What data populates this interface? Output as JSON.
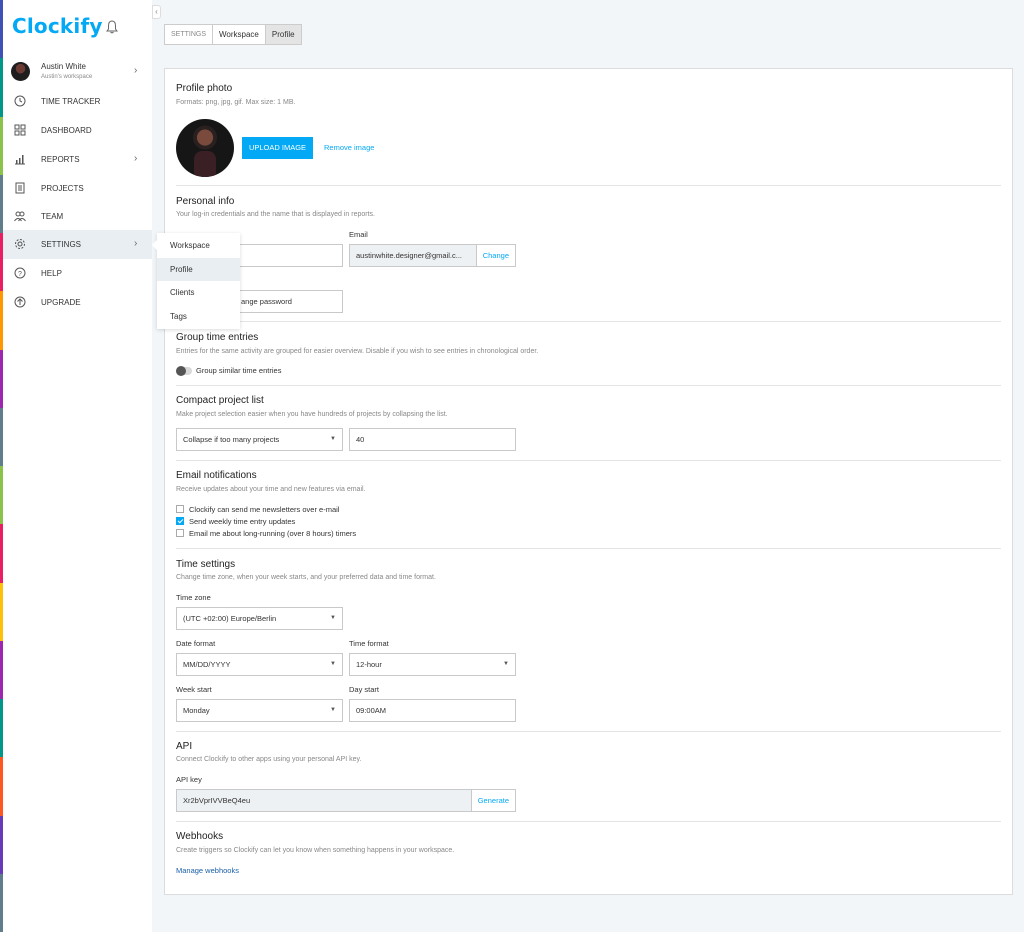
{
  "app": {
    "name": "Clockify",
    "accent": "#03a9f4"
  },
  "strip_colors": [
    "#3f51b5",
    "#009688",
    "#8bc34a",
    "#607d8b",
    "#e91e63",
    "#ff9800",
    "#9c27b0",
    "#607d8b",
    "#8bc34a",
    "#e91e63",
    "#ffc107",
    "#9c27b0",
    "#009688",
    "#ff5722",
    "#673ab7",
    "#607d8b"
  ],
  "user": {
    "name": "Austin White",
    "workspace": "Austin's workspace"
  },
  "nav": [
    {
      "label": "TIME TRACKER",
      "icon": "clock-icon"
    },
    {
      "label": "DASHBOARD",
      "icon": "grid-icon"
    },
    {
      "label": "REPORTS",
      "icon": "chart-icon"
    },
    {
      "label": "PROJECTS",
      "icon": "document-icon"
    },
    {
      "label": "TEAM",
      "icon": "team-icon"
    },
    {
      "label": "SETTINGS",
      "icon": "gear-icon"
    },
    {
      "label": "HELP",
      "icon": "help-icon"
    },
    {
      "label": "UPGRADE",
      "icon": "upgrade-icon"
    }
  ],
  "settings_menu": [
    "Workspace",
    "Profile",
    "Clients",
    "Tags"
  ],
  "tabs": [
    "SETTINGS",
    "Workspace",
    "Profile"
  ],
  "profile_photo": {
    "title": "Profile photo",
    "subtitle": "Formats: png, jpg, gif. Max size: 1 MB.",
    "upload_label": "UPLOAD IMAGE",
    "remove_label": "Remove image"
  },
  "personal_info": {
    "title": "Personal info",
    "subtitle": "Your log-in credentials and the name that is displayed in reports.",
    "email_label": "Email",
    "email_value": "austinwhite.designer@gmail.c...",
    "change_label": "Change",
    "password_button": "ange password"
  },
  "group_entries": {
    "title": "Group time entries",
    "subtitle": "Entries for the same activity are grouped for easier overview. Disable if you wish to see entries in chronological order.",
    "toggle_label": "Group similar time entries"
  },
  "compact_list": {
    "title": "Compact project list",
    "subtitle": "Make project selection easier when you have hundreds of projects by collapsing the list.",
    "select_value": "Collapse if too many projects",
    "number_value": "40"
  },
  "email_notifications": {
    "title": "Email notifications",
    "subtitle": "Receive updates about your time and new features via email.",
    "options": [
      {
        "label": "Clockify can send me newsletters over e-mail",
        "checked": false
      },
      {
        "label": "Send weekly time entry updates",
        "checked": true
      },
      {
        "label": "Email me about long-running (over 8 hours) timers",
        "checked": false
      }
    ]
  },
  "time_settings": {
    "title": "Time settings",
    "subtitle": "Change time zone, when your week starts, and your preferred data and time format.",
    "timezone_label": "Time zone",
    "timezone_value": "(UTC +02:00) Europe/Berlin",
    "date_format_label": "Date format",
    "date_format_value": "MM/DD/YYYY",
    "time_format_label": "Time format",
    "time_format_value": "12-hour",
    "week_start_label": "Week start",
    "week_start_value": "Monday",
    "day_start_label": "Day start",
    "day_start_value": "09:00AM"
  },
  "api": {
    "title": "API",
    "subtitle": "Connect Clockify to other apps using your personal API key.",
    "key_label": "API key",
    "key_value": "Xr2bVprIVVBeQ4eu",
    "generate_label": "Generate"
  },
  "webhooks": {
    "title": "Webhooks",
    "subtitle": "Create triggers so Clockify can let you know when something happens in your workspace.",
    "manage_label": "Manage webhooks"
  }
}
